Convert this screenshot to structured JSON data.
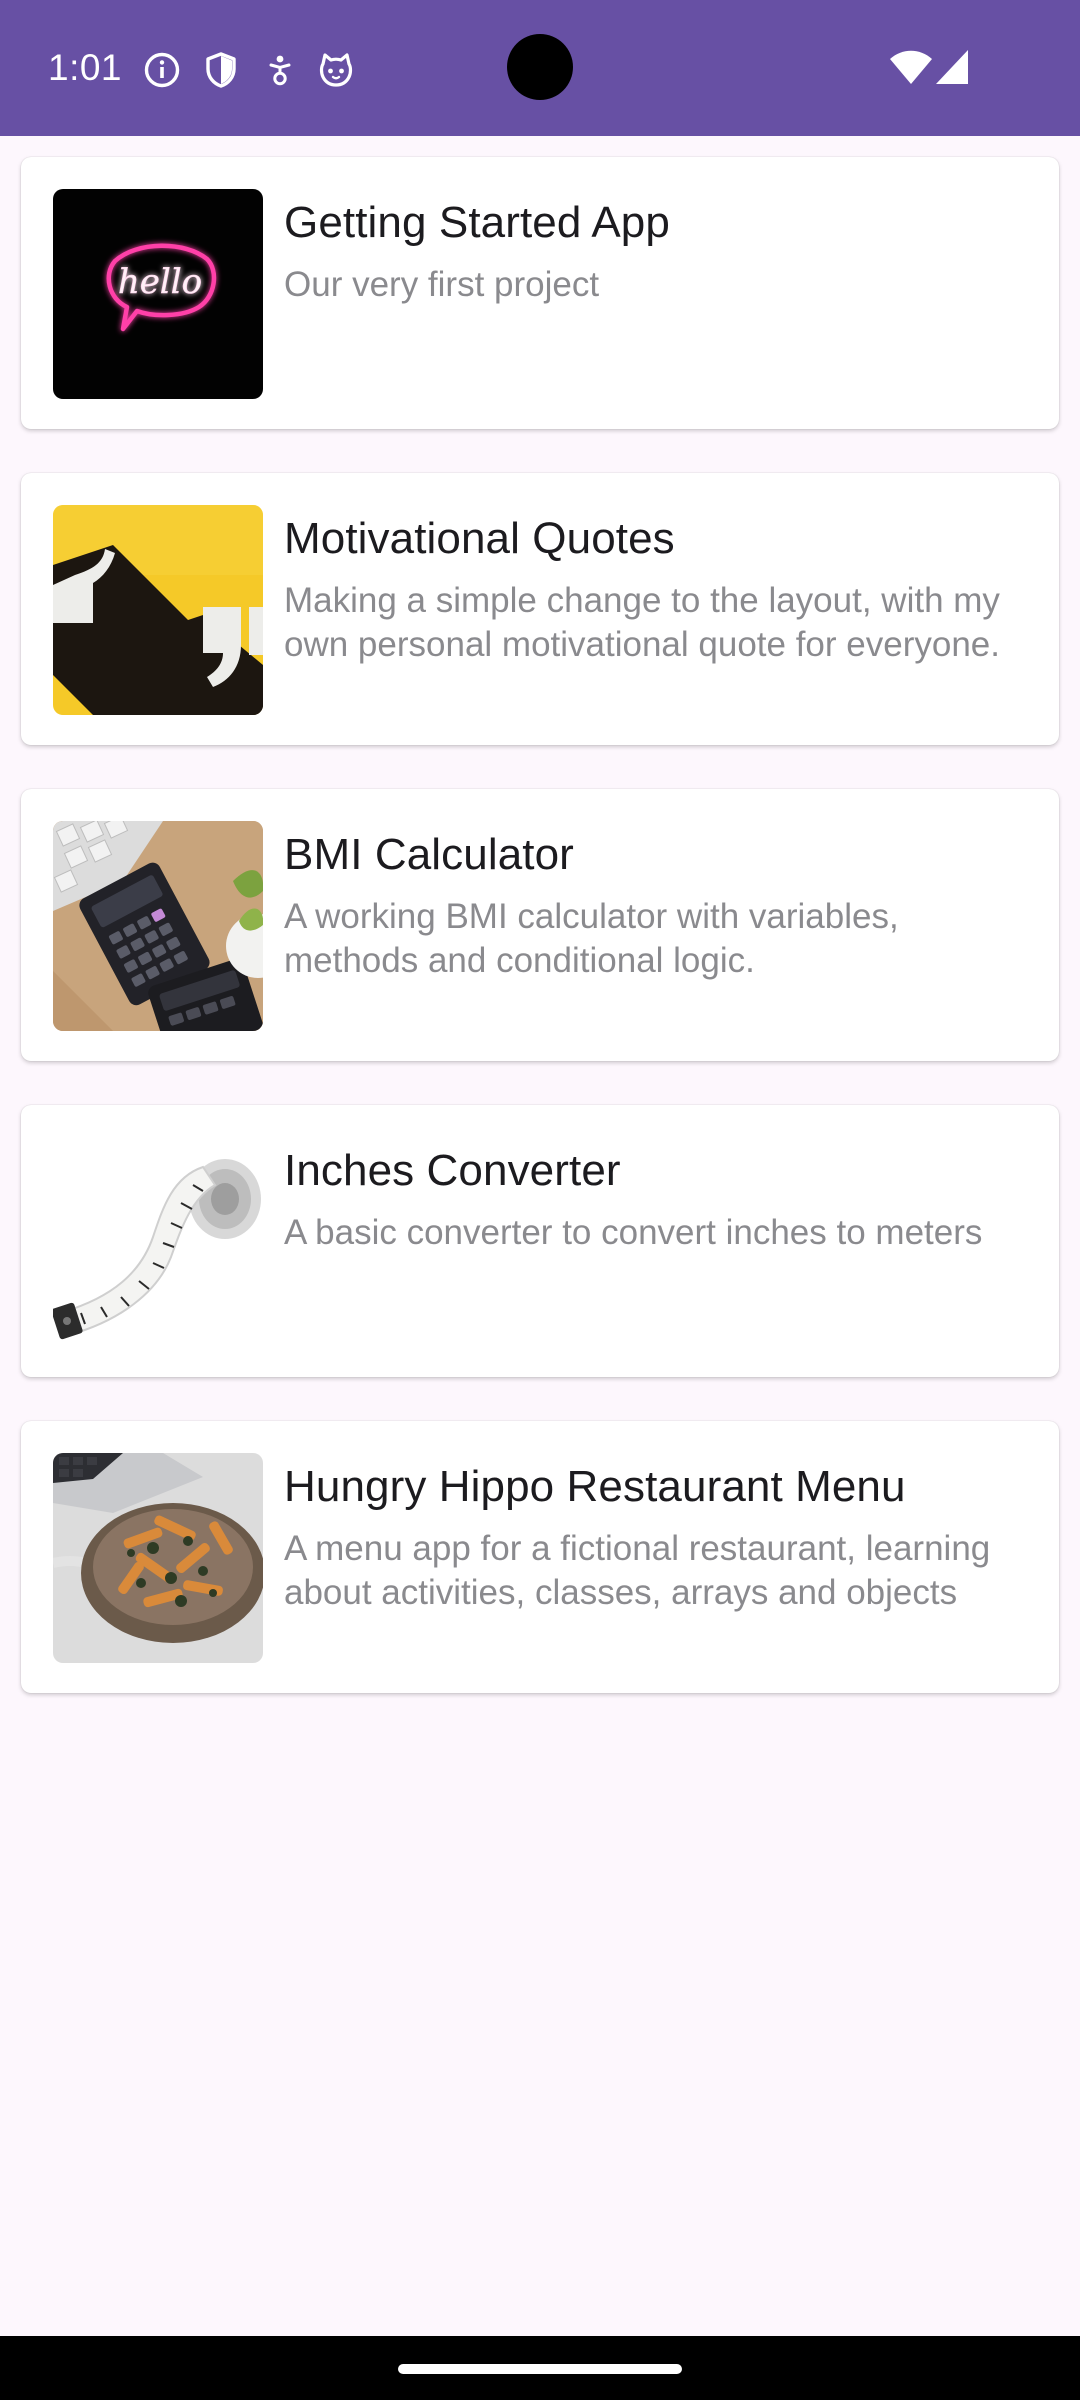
{
  "status_bar": {
    "time": "1:01",
    "left_icons": [
      "info-icon",
      "shield-icon",
      "accessibility-icon",
      "cat-face-icon"
    ],
    "right_icons": [
      "wifi-icon",
      "cell-signal-icon"
    ],
    "background_color": "#6750a4"
  },
  "projects": [
    {
      "title": "Getting Started App",
      "description": "Our very first project",
      "thumbnail": "hello-neon-sign-image"
    },
    {
      "title": "Motivational Quotes",
      "description": "Making a simple change to the layout, with my own personal motivational quote for everyone.",
      "thumbnail": "quote-marks-image"
    },
    {
      "title": "BMI Calculator",
      "description": "A working BMI calculator with variables, methods and conditional logic.",
      "thumbnail": "calculator-desk-image"
    },
    {
      "title": "Inches Converter",
      "description": "A basic converter to convert inches to meters",
      "thumbnail": "tape-measure-image"
    },
    {
      "title": "Hungry Hippo Restaurant Menu",
      "description": "A menu app for a fictional restaurant, learning about activities, classes, arrays and objects",
      "thumbnail": "pasta-bowl-image"
    }
  ],
  "colors": {
    "page_background": "#fdf7fd",
    "card_background": "#ffffff",
    "title_text": "#1c1b1f",
    "description_text": "#8a8a8e"
  }
}
